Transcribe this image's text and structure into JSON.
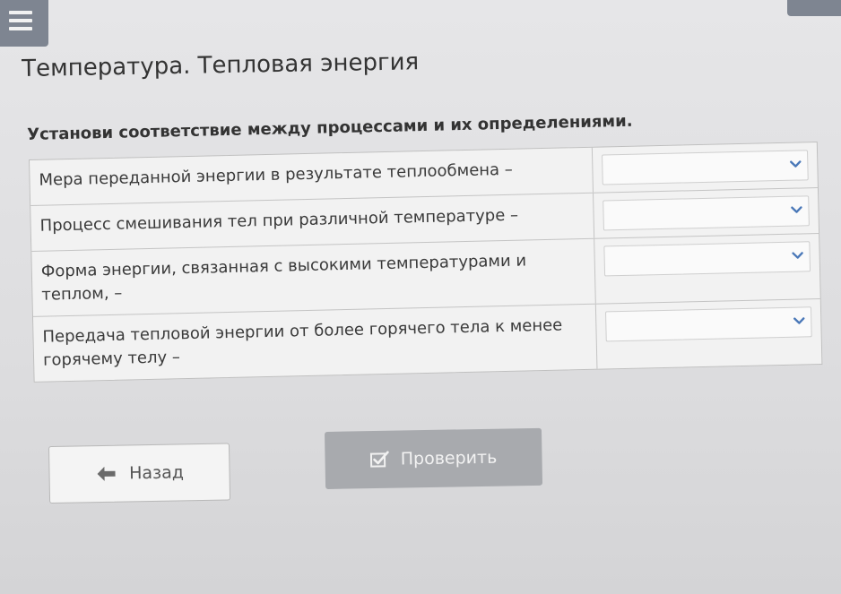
{
  "header": {
    "menu_icon": "hamburger-menu-icon"
  },
  "page": {
    "title": "Температура. Тепловая энергия",
    "instruction": "Установи соответствие между процессами и их определениями."
  },
  "rows": [
    {
      "text": "Мера переданной энергии в результате теплообмена –",
      "selected": ""
    },
    {
      "text": "Процесс смешивания тел при различной температуре –",
      "selected": ""
    },
    {
      "text": "Форма энергии, связанная с высокими температурами и теплом, –",
      "selected": ""
    },
    {
      "text": "Передача тепловой энергии от более горячего тела к менее горячему телу –",
      "selected": ""
    }
  ],
  "buttons": {
    "back_label": "Назад",
    "back_icon": "arrow-left-icon",
    "check_label": "Проверить",
    "check_icon": "checkbox-check-icon"
  },
  "colors": {
    "menu_bg": "#7e8591",
    "check_button_bg": "#a8aaae",
    "text": "#333333"
  }
}
